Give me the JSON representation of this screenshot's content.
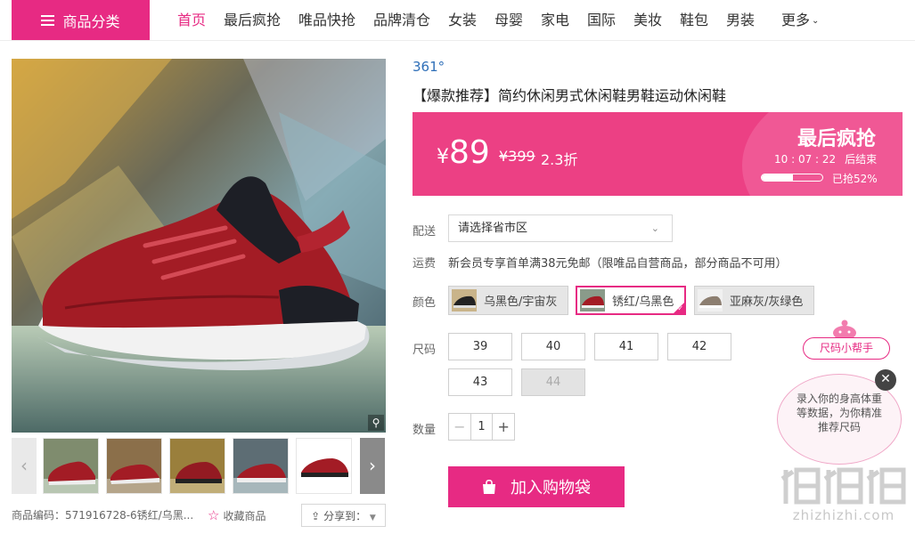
{
  "nav": {
    "category_label": "商品分类",
    "links": [
      "首页",
      "最后疯抢",
      "唯品快抢",
      "品牌清仓",
      "女装",
      "母婴",
      "家电",
      "国际",
      "美妆",
      "鞋包",
      "男装"
    ],
    "more_label": "更多",
    "accent": "#e72a83"
  },
  "gallery": {
    "sku_code": "商品编码：571916728-6锈红/乌黑...",
    "favorite_label": "收藏商品",
    "share_label": "分享到："
  },
  "product": {
    "brand": "361°",
    "title": "【爆款推荐】简约休闲男式休闲鞋男鞋运动休闲鞋"
  },
  "promo": {
    "currency": "¥",
    "price": "89",
    "original_price": "¥399",
    "discount": "2.3折",
    "title": "最后疯抢",
    "countdown": "10 : 07 : 22",
    "countdown_suffix": "后结束",
    "sold_fraction": 0.52,
    "sold_text": "已抢52%",
    "bg_color": "#ec4084"
  },
  "delivery": {
    "label": "配送",
    "region_placeholder": "请选择省市区"
  },
  "shipping": {
    "label": "运费",
    "text": "新会员专享首单满38元免邮（限唯品自营商品，部分商品不可用）"
  },
  "color": {
    "label": "颜色",
    "options": [
      {
        "name": "乌黑色/宇宙灰",
        "selected": false
      },
      {
        "name": "锈红/乌黑色",
        "selected": true
      },
      {
        "name": "亚麻灰/灰绿色",
        "selected": false
      }
    ]
  },
  "size": {
    "label": "尺码",
    "options": [
      {
        "value": "39",
        "available": true
      },
      {
        "value": "40",
        "available": true
      },
      {
        "value": "41",
        "available": true
      },
      {
        "value": "42",
        "available": true
      },
      {
        "value": "43",
        "available": true
      },
      {
        "value": "44",
        "available": false
      }
    ]
  },
  "quantity": {
    "label": "数量",
    "value": "1",
    "minus": "−",
    "plus": "+"
  },
  "cart": {
    "label": "加入购物袋"
  },
  "size_helper": {
    "title": "尺码小帮手",
    "text": "录入你的身高体重等数据，为你精准推荐尺码",
    "close": "✕"
  },
  "watermark": {
    "url": "zhizhizhi.com"
  }
}
